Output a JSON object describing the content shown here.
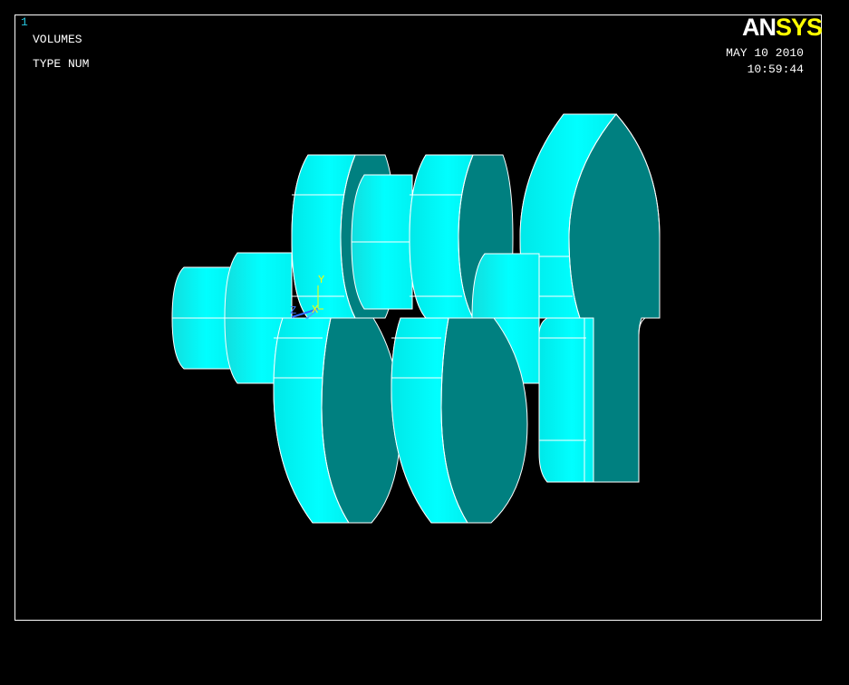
{
  "window": {
    "number": "1",
    "plot_label": "VOLUMES",
    "plot_option": "TYPE NUM",
    "date": "MAY 10 2010",
    "time": "10:59:44"
  },
  "logo": {
    "part1": "AN",
    "part2": "SYS"
  },
  "triad": {
    "x_label": "X",
    "y_label": "Y",
    "z_label": "Z"
  },
  "colors": {
    "background": "#000000",
    "face_light": "#00ffff",
    "face_dark": "#008080",
    "edge": "#ffffff",
    "logo_accent": "#ffff00",
    "triad": "#ffff00"
  },
  "icons": {
    "axis_triad": "xyz-axis-triad-icon",
    "model": "crankshaft-volumes-model"
  }
}
